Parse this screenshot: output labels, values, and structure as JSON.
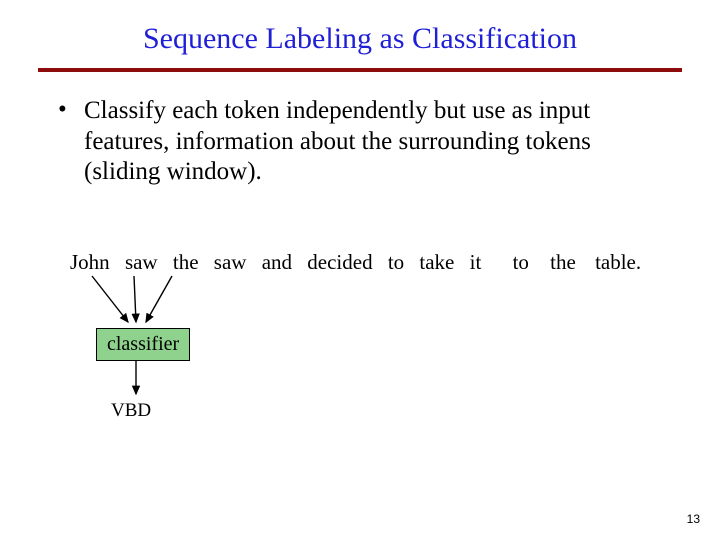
{
  "title": "Sequence Labeling as Classification",
  "bullet": "Classify each token independently but use as input features, information about the surrounding tokens (sliding window).",
  "tokens": [
    "John",
    "saw",
    "the",
    "saw",
    "and",
    "decided",
    "to",
    "take",
    "it",
    "to",
    "the",
    "table."
  ],
  "classifier_label": "classifier",
  "output_tag": "VBD",
  "page_number": "13"
}
